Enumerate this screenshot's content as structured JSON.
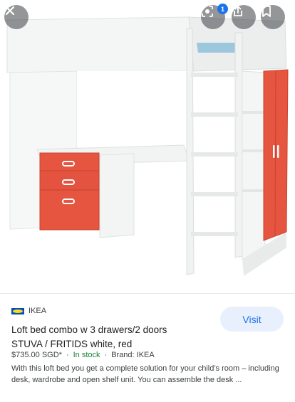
{
  "result": {
    "source_name": "IKEA",
    "title_line1": "Loft bed combo w 3 drawers/2 doors",
    "title_line2": "STUVA / FRITIDS white, red",
    "price": "$735.00 SGD*",
    "stock": "In stock",
    "brand": "Brand: IKEA",
    "description": "With this loft bed you get a complete solution for your child’s room – including desk, wardrobe and open shelf unit. You can assemble the desk ..."
  },
  "actions": {
    "visit_label": "Visit",
    "lens_badge_count": "1"
  },
  "icons": {
    "close": "close-icon",
    "lens": "lens-icon",
    "share": "share-icon",
    "save": "bookmark-icon"
  },
  "colors": {
    "accent": "#1a73e8",
    "stock_green": "#188038",
    "furniture_red": "#e5553f"
  }
}
